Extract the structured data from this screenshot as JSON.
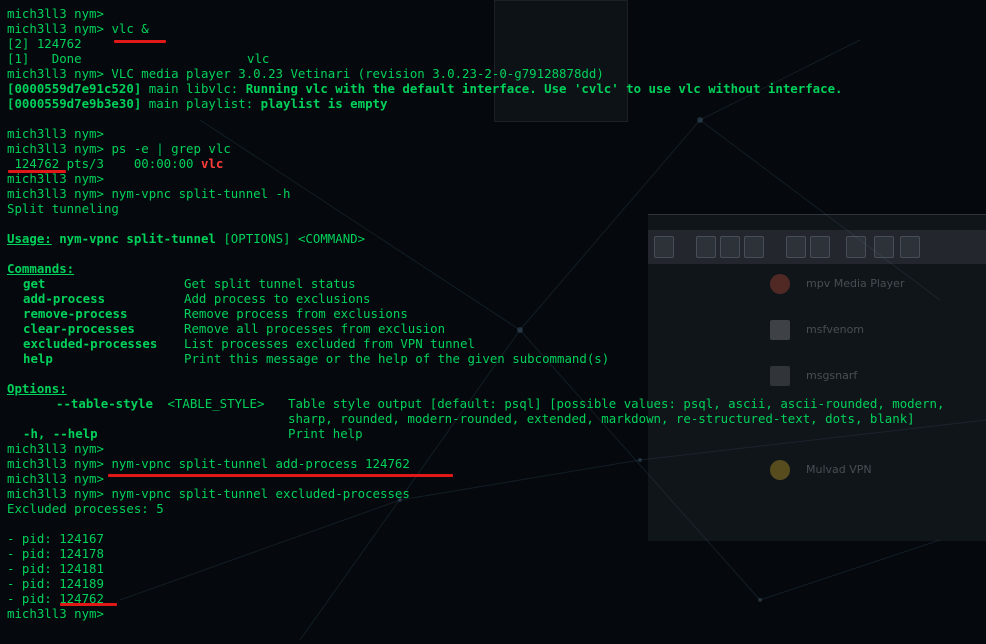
{
  "prompt": "mich3ll3 nym> ",
  "lines": {
    "l0": "mich3ll3 nym>",
    "l1_cmd": "vlc &",
    "l2": "[2] 124762",
    "l3_a": "[1]   Done",
    "l3_b": "vlc",
    "l4": "mich3ll3 nym> VLC media player 3.0.23 Vetinari (revision 3.0.23-2-0-g79128878dd)",
    "l5_addr": "[0000559d7e91c520]",
    "l5_mod": " main libvlc: ",
    "l5_msg": "Running vlc with the default interface. Use 'cvlc' to use vlc without interface.",
    "l6_addr": "[0000559d7e9b3e30]",
    "l6_mod": " main playlist: ",
    "l6_msg": "playlist is empty",
    "l8": "mich3ll3 nym>",
    "l9_cmd": "ps -e | grep vlc",
    "l10_pid": " 124762",
    "l10_tty": " pts/3    00:00:00 ",
    "l10_name": "vlc",
    "l11": "mich3ll3 nym>",
    "l12_cmd": "nym-vpnc split-tunnel -h",
    "l13": "Split tunneling",
    "l15_usage": "Usage:",
    "l15_cmd": " nym-vpnc split-tunnel",
    "l15_rest": " [OPTIONS] <COMMAND>",
    "l17_commands": "Commands:",
    "commands": [
      {
        "name": "get",
        "desc": "Get split tunnel status"
      },
      {
        "name": "add-process",
        "desc": "Add process to exclusions"
      },
      {
        "name": "remove-process",
        "desc": "Remove process from exclusions"
      },
      {
        "name": "clear-processes",
        "desc": "Remove all processes from exclusion"
      },
      {
        "name": "excluded-processes",
        "desc": "List processes excluded from VPN tunnel"
      },
      {
        "name": "help",
        "desc": "Print this message or the help of the given subcommand(s)"
      }
    ],
    "options_label": "Options:",
    "opt1_flag": "--table-style",
    "opt1_arg": " <TABLE_STYLE>",
    "opt1_desc1": "Table style output [default: psql] [possible values: psql, ascii, ascii-rounded, modern,",
    "opt1_desc2": "sharp, rounded, modern-rounded, extended, markdown, re-structured-text, dots, blank]",
    "opt2_flag": "-h, --help",
    "opt2_desc": "Print help",
    "l30": "mich3ll3 nym>",
    "l31_cmd": "nym-vpnc split-tunnel add-process 124762",
    "l32": "mich3ll3 nym>",
    "l33_cmd": "nym-vpnc split-tunnel excluded-processes",
    "l34": "Excluded processes: 5",
    "pids": [
      "- pid: 124167",
      "- pid: 124178",
      "- pid: 124181",
      "- pid: 124189"
    ],
    "pid_last_prefix": "- pid: ",
    "pid_last_value": "124762",
    "final_prompt": "mich3ll3 nym>"
  },
  "background_app": {
    "items": [
      "mpv Media Player",
      "msfvenom",
      "msgsnarf",
      "Mulvad VPN"
    ]
  },
  "colors": {
    "text": "#00d15a",
    "vlc_name": "#ff3b3b",
    "underline_mark": "#e01818",
    "background": "#05090d"
  }
}
